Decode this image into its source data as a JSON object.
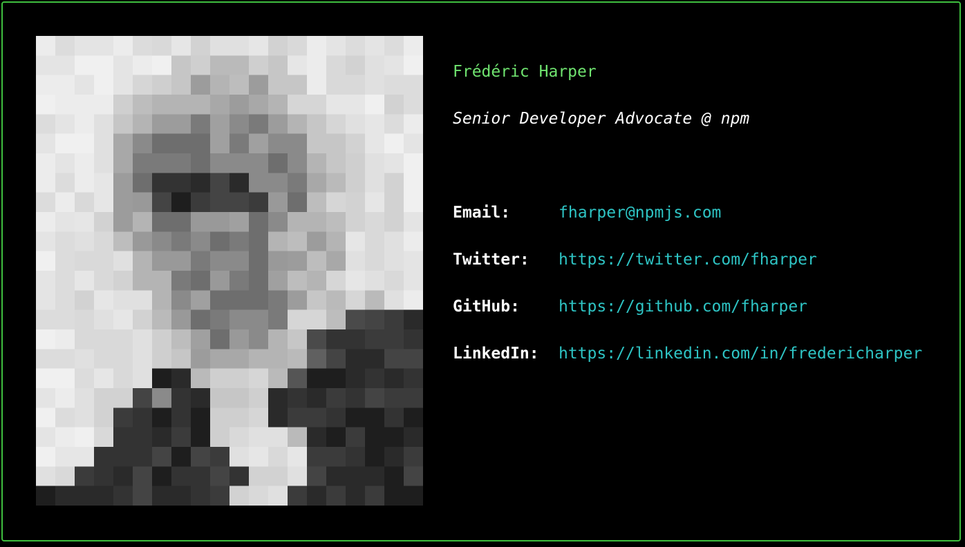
{
  "profile": {
    "name": "Frédéric Harper",
    "title": "Senior Developer Advocate @ npm"
  },
  "contacts": [
    {
      "label": "Email:",
      "value": "fharper@npmjs.com"
    },
    {
      "label": "Twitter:",
      "value": "https://twitter.com/fharper"
    },
    {
      "label": "GitHub:",
      "value": "https://github.com/fharper"
    },
    {
      "label": "LinkedIn:",
      "value": "https://linkedin.com/in/fredericharper"
    }
  ],
  "colors": {
    "frame": "#3fbf3f",
    "name": "#6fe36f",
    "link": "#2ec4c4",
    "text": "#ffffff",
    "background": "#000000"
  }
}
